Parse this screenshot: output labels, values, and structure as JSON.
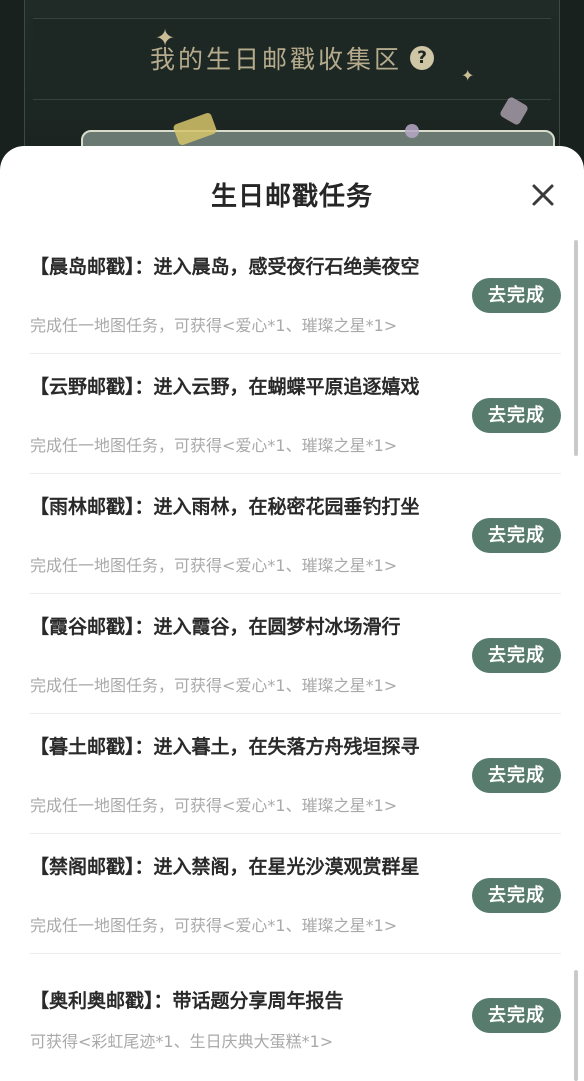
{
  "background": {
    "title": "我的生日邮戳收集区",
    "help_icon": "?"
  },
  "sheet": {
    "title": "生日邮戳任务",
    "close_icon": "close-icon"
  },
  "tasks": [
    {
      "title": "【晨岛邮戳】：进入晨岛，感受夜行石绝美夜空",
      "reward": "完成任一地图任务，可获得<爱心*1、璀璨之星*1>",
      "button": "去完成"
    },
    {
      "title": "【云野邮戳】：进入云野，在蝴蝶平原追逐嬉戏",
      "reward": "完成任一地图任务，可获得<爱心*1、璀璨之星*1>",
      "button": "去完成"
    },
    {
      "title": "【雨林邮戳】：进入雨林，在秘密花园垂钓打坐",
      "reward": "完成任一地图任务，可获得<爱心*1、璀璨之星*1>",
      "button": "去完成"
    },
    {
      "title": "【霞谷邮戳】：进入霞谷，在圆梦村冰场滑行",
      "reward": "完成任一地图任务，可获得<爱心*1、璀璨之星*1>",
      "button": "去完成"
    },
    {
      "title": "【暮土邮戳】：进入暮土，在失落方舟残垣探寻",
      "reward": "完成任一地图任务，可获得<爱心*1、璀璨之星*1>",
      "button": "去完成"
    },
    {
      "title": "【禁阁邮戳】：进入禁阁，在星光沙漠观赏群星",
      "reward": "完成任一地图任务，可获得<爱心*1、璀璨之星*1>",
      "button": "去完成"
    },
    {
      "title": "【奥利奥邮戳】：带话题分享周年报告",
      "reward": "可获得<彩虹尾迹*1、生日庆典大蛋糕*1>",
      "button": "去完成"
    }
  ],
  "colors": {
    "button_bg": "#577c6e",
    "backdrop": "#18211e"
  }
}
